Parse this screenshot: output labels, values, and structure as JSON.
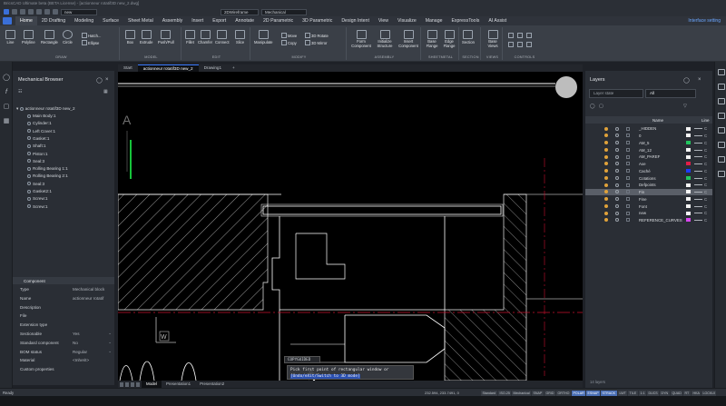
{
  "window": {
    "title": "BricsCAD Ultimate beta (BETA License) - [actionneur rotatif3D new_2.dwg]"
  },
  "quick_access": {
    "workspace": "new",
    "style": "2DWireframe",
    "profile": "Mechanical"
  },
  "ribbon_tabs": [
    {
      "label": "Home",
      "active": true
    },
    {
      "label": "2D Drafting"
    },
    {
      "label": "Modeling"
    },
    {
      "label": "Surface"
    },
    {
      "label": "Sheet Metal"
    },
    {
      "label": "Assembly"
    },
    {
      "label": "Insert"
    },
    {
      "label": "Export"
    },
    {
      "label": "Annotate"
    },
    {
      "label": "2D Parametric"
    },
    {
      "label": "3D Parametric"
    },
    {
      "label": "Design Intent"
    },
    {
      "label": "View"
    },
    {
      "label": "Visualize"
    },
    {
      "label": "Manage"
    },
    {
      "label": "ExpressTools"
    },
    {
      "label": "AI Assist"
    }
  ],
  "ribbon_right": "Interface setting",
  "ribbon_groups": {
    "draw": {
      "label": "DRAW",
      "tools": [
        "Line",
        "Polyline",
        "Rectangle",
        "Circle"
      ],
      "small": [
        "Hatch...",
        "Ellipse"
      ]
    },
    "model": {
      "label": "MODEL",
      "tools": [
        "Box",
        "Extrude",
        "Push/Pull"
      ]
    },
    "edit": {
      "label": "EDIT",
      "tools": [
        "Fillet",
        "Chamfer",
        "Connect",
        "Slice"
      ]
    },
    "modify": {
      "label": "MODIFY",
      "tools": [
        "Manipulate"
      ],
      "small": [
        "Move",
        "Copy",
        "3D Rotate",
        "3D Mirror"
      ]
    },
    "assembly": {
      "label": "ASSEMBLY",
      "tools": [
        "Form Component",
        "Initialize Structure",
        "Insert Component"
      ]
    },
    "sheetmetal": {
      "label": "SHEETMETAL",
      "tools": [
        "Base Flange",
        "Edge Flange"
      ]
    },
    "section": {
      "label": "SECTION",
      "tools": [
        "Section"
      ]
    },
    "views": {
      "label": "VIEWS",
      "tools": [
        "Base Views"
      ]
    },
    "controls": {
      "label": "CONTROLS"
    }
  },
  "doc_tabs": [
    {
      "label": "Start"
    },
    {
      "label": "actionneur rotatif3D new_2",
      "active": true
    },
    {
      "label": "Drawing1"
    }
  ],
  "mechanical_browser": {
    "title": "Mechanical Browser",
    "root": "actionneur rotatif3D new_2",
    "items": [
      "Main Body:1",
      "Cylinder:1",
      "Left Cover:1",
      "Gasket:1",
      "Shaft:1",
      "Piston:1",
      "Seal:3",
      "Rolling Bearing 1:1",
      "Rolling Bearing 2:1",
      "Seal:3",
      "Gasket2:1",
      "Screw:1",
      "Screw:1"
    ],
    "section_title": "Component",
    "properties": [
      {
        "key": "Type",
        "value": "Mechanical block"
      },
      {
        "key": "Name",
        "value": "actionneur rotatif"
      },
      {
        "key": "Description",
        "value": ""
      },
      {
        "key": "File",
        "value": ""
      },
      {
        "key": "Extension type",
        "value": ""
      },
      {
        "key": "Sectionable",
        "value": "Yes"
      },
      {
        "key": "Standard component",
        "value": "No"
      },
      {
        "key": "BOM status",
        "value": "Regular"
      },
      {
        "key": "Material",
        "value": "<Inherit>"
      },
      {
        "key": "Custom properties",
        "value": ""
      }
    ]
  },
  "command": {
    "title": "COPYGUIDED",
    "line1": "Pick first point of rectangular window or",
    "line2": "[Undo/eXit/Switch to 3D mode]"
  },
  "layout_tabs": [
    {
      "label": "Model",
      "active": true
    },
    {
      "label": "Presentation1"
    },
    {
      "label": "Presentation2"
    }
  ],
  "layers": {
    "title": "Layers",
    "filter_placeholder": "Layer state",
    "filter_value": "All",
    "header_name": "Name",
    "header_line": "Line",
    "rows": [
      {
        "name": "_HIDDEN",
        "color": "#f4f4f4"
      },
      {
        "name": "0",
        "color": "#f4f4f4"
      },
      {
        "name": "AM_5",
        "color": "#22c55e"
      },
      {
        "name": "AM_12",
        "color": "#f4f4f4"
      },
      {
        "name": "AM_PAREF",
        "color": "#f4f4f4"
      },
      {
        "name": "Axe",
        "color": "#e11d48"
      },
      {
        "name": "Caché",
        "color": "#1e3aff"
      },
      {
        "name": "Cotations",
        "color": "#22c55e"
      },
      {
        "name": "Defpoints",
        "color": "#f4f4f4"
      },
      {
        "name": "Fin",
        "color": "#f4f4f4",
        "selected": true
      },
      {
        "name": "Fine",
        "color": "#f4f4f4"
      },
      {
        "name": "Font",
        "color": "#f4f4f4"
      },
      {
        "name": "new",
        "color": "#f4f4f4"
      },
      {
        "name": "REFERENCE_CURVES",
        "color": "#d946ef"
      }
    ],
    "count_text": "14 layers"
  },
  "status": {
    "ready": "Ready",
    "coords": "232.594, 233.7491, 0",
    "toggles": [
      {
        "label": "Standard"
      },
      {
        "label": "ISO-25"
      },
      {
        "label": "Mechanical"
      },
      {
        "label": "SNAP"
      },
      {
        "label": "GRID"
      },
      {
        "label": "ORTHO"
      },
      {
        "label": "POLAR",
        "on": true
      },
      {
        "label": "ESNAP",
        "on": true
      },
      {
        "label": "STRACK",
        "on": true
      },
      {
        "label": "LWT"
      },
      {
        "label": "TILE"
      },
      {
        "label": "1:1"
      },
      {
        "label": "DUCS"
      },
      {
        "label": "DYN"
      },
      {
        "label": "QUAD"
      },
      {
        "label": "RT"
      },
      {
        "label": "HKA"
      },
      {
        "label": "LOCKUI"
      },
      {
        "label": "None"
      }
    ]
  },
  "canvas": {
    "coord_label_w": "W"
  }
}
